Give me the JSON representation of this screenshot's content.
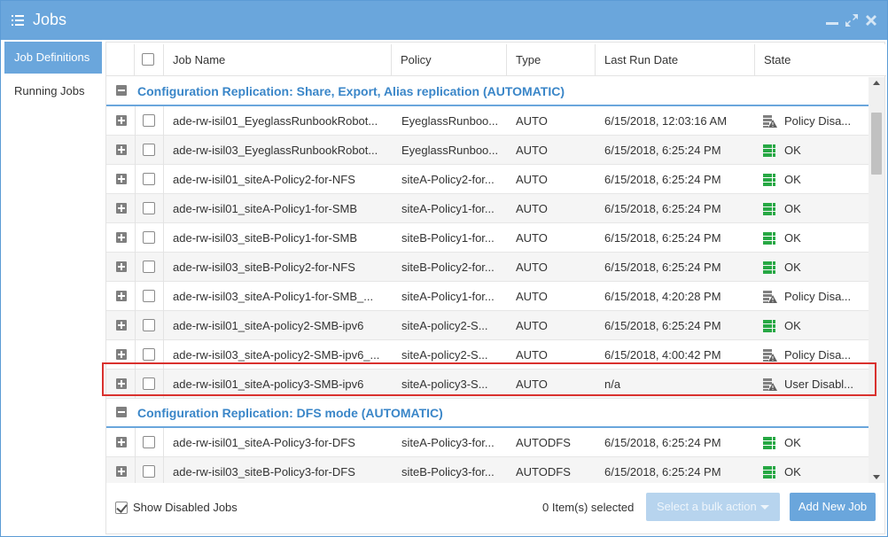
{
  "window": {
    "title": "Jobs",
    "controls": [
      "minimize-icon",
      "maximize-icon",
      "close-icon"
    ]
  },
  "sidebar": {
    "items": [
      {
        "label": "Job Definitions",
        "active": true
      },
      {
        "label": "Running Jobs",
        "active": false
      }
    ]
  },
  "table": {
    "columns": [
      "Job Name",
      "Policy",
      "Type",
      "Last Run Date",
      "State"
    ],
    "groups": [
      {
        "title": "Configuration Replication: Share, Export, Alias replication (AUTOMATIC)",
        "rows": [
          {
            "name": "ade-rw-isil01_EyeglassRunbookRobot...",
            "policy": "EyeglassRunboo...",
            "type": "AUTO",
            "last_run": "6/15/2018, 12:03:16 AM",
            "state": "Policy Disa...",
            "state_icon": "disabled-warning-icon"
          },
          {
            "name": "ade-rw-isil03_EyeglassRunbookRobot...",
            "policy": "EyeglassRunboo...",
            "type": "AUTO",
            "last_run": "6/15/2018, 6:25:24 PM",
            "state": "OK",
            "state_icon": "ok-stack-icon"
          },
          {
            "name": "ade-rw-isil01_siteA-Policy2-for-NFS",
            "policy": "siteA-Policy2-for...",
            "type": "AUTO",
            "last_run": "6/15/2018, 6:25:24 PM",
            "state": "OK",
            "state_icon": "ok-stack-icon"
          },
          {
            "name": "ade-rw-isil01_siteA-Policy1-for-SMB",
            "policy": "siteA-Policy1-for...",
            "type": "AUTO",
            "last_run": "6/15/2018, 6:25:24 PM",
            "state": "OK",
            "state_icon": "ok-stack-icon"
          },
          {
            "name": "ade-rw-isil03_siteB-Policy1-for-SMB",
            "policy": "siteB-Policy1-for...",
            "type": "AUTO",
            "last_run": "6/15/2018, 6:25:24 PM",
            "state": "OK",
            "state_icon": "ok-stack-icon"
          },
          {
            "name": "ade-rw-isil03_siteB-Policy2-for-NFS",
            "policy": "siteB-Policy2-for...",
            "type": "AUTO",
            "last_run": "6/15/2018, 6:25:24 PM",
            "state": "OK",
            "state_icon": "ok-stack-icon"
          },
          {
            "name": "ade-rw-isil03_siteA-Policy1-for-SMB_...",
            "policy": "siteA-Policy1-for...",
            "type": "AUTO",
            "last_run": "6/15/2018, 4:20:28 PM",
            "state": "Policy Disa...",
            "state_icon": "disabled-warning-icon"
          },
          {
            "name": "ade-rw-isil01_siteA-policy2-SMB-ipv6",
            "policy": "siteA-policy2-S...",
            "type": "AUTO",
            "last_run": "6/15/2018, 6:25:24 PM",
            "state": "OK",
            "state_icon": "ok-stack-icon"
          },
          {
            "name": "ade-rw-isil03_siteA-policy2-SMB-ipv6_...",
            "policy": "siteA-policy2-S...",
            "type": "AUTO",
            "last_run": "6/15/2018, 4:00:42 PM",
            "state": "Policy Disa...",
            "state_icon": "disabled-warning-icon"
          },
          {
            "name": "ade-rw-isil01_siteA-policy3-SMB-ipv6",
            "policy": "siteA-policy3-S...",
            "type": "AUTO",
            "last_run": "n/a",
            "state": "User Disabl...",
            "state_icon": "disabled-warning-icon",
            "highlighted": true
          }
        ]
      },
      {
        "title": "Configuration Replication: DFS mode (AUTOMATIC)",
        "rows": [
          {
            "name": "ade-rw-isil01_siteA-Policy3-for-DFS",
            "policy": "siteA-Policy3-for...",
            "type": "AUTODFS",
            "last_run": "6/15/2018, 6:25:24 PM",
            "state": "OK",
            "state_icon": "ok-stack-icon"
          },
          {
            "name": "ade-rw-isil03_siteB-Policy3-for-DFS",
            "policy": "siteB-Policy3-for...",
            "type": "AUTODFS",
            "last_run": "6/15/2018, 6:25:24 PM",
            "state": "OK",
            "state_icon": "ok-stack-icon"
          }
        ]
      }
    ]
  },
  "footer": {
    "show_disabled_label": "Show Disabled Jobs",
    "show_disabled_checked": true,
    "selected_count": "0 Item(s) selected",
    "bulk_action_placeholder": "Select a bulk action",
    "add_button": "Add New Job"
  },
  "colors": {
    "accent": "#6aa6dc",
    "group_title": "#3a86c8",
    "ok_green": "#27a844",
    "highlight_border": "#d9312e"
  }
}
